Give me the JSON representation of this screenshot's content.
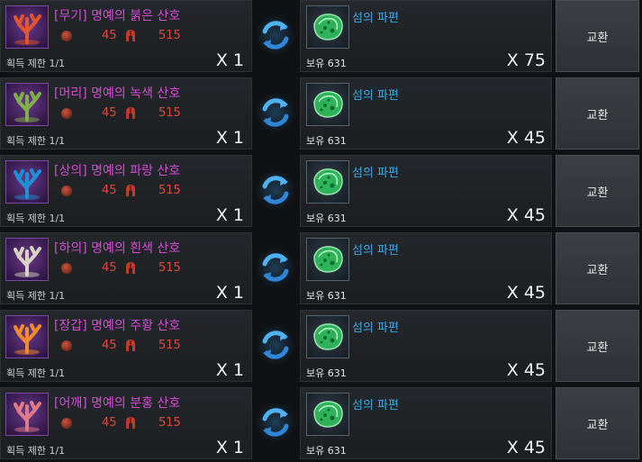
{
  "rows": [
    {
      "item_name": "[무기] 명예의 붉은 산호",
      "coral_color": "#e4552f",
      "cost_a": "45",
      "cost_b": "515",
      "limit": "획득 제한 1/1",
      "qty": "X 1",
      "reward_name": "섬의 파편",
      "owned": "보유 631",
      "reward_qty": "X 75",
      "button": "교환"
    },
    {
      "item_name": "[머리] 명예의 녹색 산호",
      "coral_color": "#7fb04a",
      "cost_a": "45",
      "cost_b": "515",
      "limit": "획득 제한 1/1",
      "qty": "X 1",
      "reward_name": "섬의 파편",
      "owned": "보유 631",
      "reward_qty": "X 45",
      "button": "교환"
    },
    {
      "item_name": "[상의] 명예의 파랑 산호",
      "coral_color": "#1f8fd6",
      "cost_a": "45",
      "cost_b": "515",
      "limit": "획득 제한 1/1",
      "qty": "X 1",
      "reward_name": "섬의 파편",
      "owned": "보유 631",
      "reward_qty": "X 45",
      "button": "교환"
    },
    {
      "item_name": "[하의] 명예의 흰색 산호",
      "coral_color": "#d8d2c2",
      "cost_a": "45",
      "cost_b": "515",
      "limit": "획득 제한 1/1",
      "qty": "X 1",
      "reward_name": "섬의 파편",
      "owned": "보유 631",
      "reward_qty": "X 45",
      "button": "교환"
    },
    {
      "item_name": "[장갑] 명예의 주황 산호",
      "coral_color": "#f08a2a",
      "cost_a": "45",
      "cost_b": "515",
      "limit": "획득 제한 1/1",
      "qty": "X 1",
      "reward_name": "섬의 파편",
      "owned": "보유 631",
      "reward_qty": "X 45",
      "button": "교환"
    },
    {
      "item_name": "[어깨] 명예의 분홍 산호",
      "coral_color": "#e07a86",
      "cost_a": "45",
      "cost_b": "515",
      "limit": "획득 제한 1/1",
      "qty": "X 1",
      "reward_name": "섬의 파편",
      "owned": "보유 631",
      "reward_qty": "X 45",
      "button": "교환"
    }
  ],
  "colors": {
    "item_name": "#d24cd6",
    "cost": "#e04a3a",
    "reward_name": "#3ea9e6",
    "swap_arrow": "#3aa0e6",
    "shard": "#3fcf6a"
  },
  "icons": {
    "coin": "coin-currency-icon",
    "helm": "helmet-currency-icon",
    "swap": "exchange-arrows-icon",
    "shard": "island-shard-icon"
  }
}
